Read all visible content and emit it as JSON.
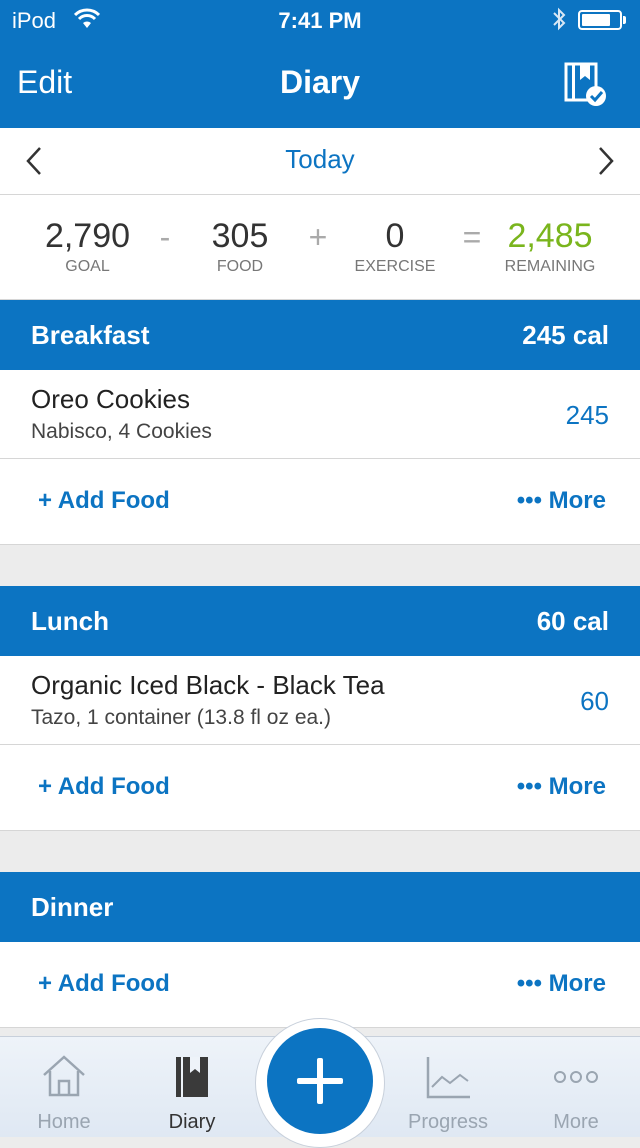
{
  "status": {
    "carrier": "iPod",
    "time": "7:41 PM"
  },
  "nav": {
    "edit_label": "Edit",
    "title": "Diary",
    "action_icon": "diary-check-icon"
  },
  "date": {
    "label": "Today"
  },
  "summary": {
    "goal": "2,790",
    "goal_label": "GOAL",
    "minus": "-",
    "food": "305",
    "food_label": "FOOD",
    "plus": "+",
    "exercise": "0",
    "exercise_label": "EXERCISE",
    "equals": "=",
    "remaining": "2,485",
    "remaining_label": "REMAINING",
    "remaining_color": "#7ab51d"
  },
  "meals": [
    {
      "name": "Breakfast",
      "cal": "245 cal",
      "items": [
        {
          "name": "Oreo Cookies",
          "desc": "Nabisco, 4 Cookies",
          "cal": "245"
        }
      ],
      "add_label": "+ Add Food",
      "more_label": "••• More"
    },
    {
      "name": "Lunch",
      "cal": "60 cal",
      "items": [
        {
          "name": "Organic Iced Black - Black Tea",
          "desc": "Tazo, 1 container (13.8 fl oz ea.)",
          "cal": "60"
        }
      ],
      "add_label": "+ Add Food",
      "more_label": "••• More"
    },
    {
      "name": "Dinner",
      "cal": "",
      "items": [],
      "add_label": "+ Add Food",
      "more_label": "••• More"
    }
  ],
  "tabs": [
    {
      "label": "Home",
      "icon": "home-icon"
    },
    {
      "label": "Diary",
      "icon": "diary-icon"
    },
    {
      "label": "Progress",
      "icon": "progress-chart-icon"
    },
    {
      "label": "More",
      "icon": "more-dots-icon"
    }
  ],
  "colors": {
    "brand": "#0c74c2",
    "green": "#7ab51d"
  }
}
